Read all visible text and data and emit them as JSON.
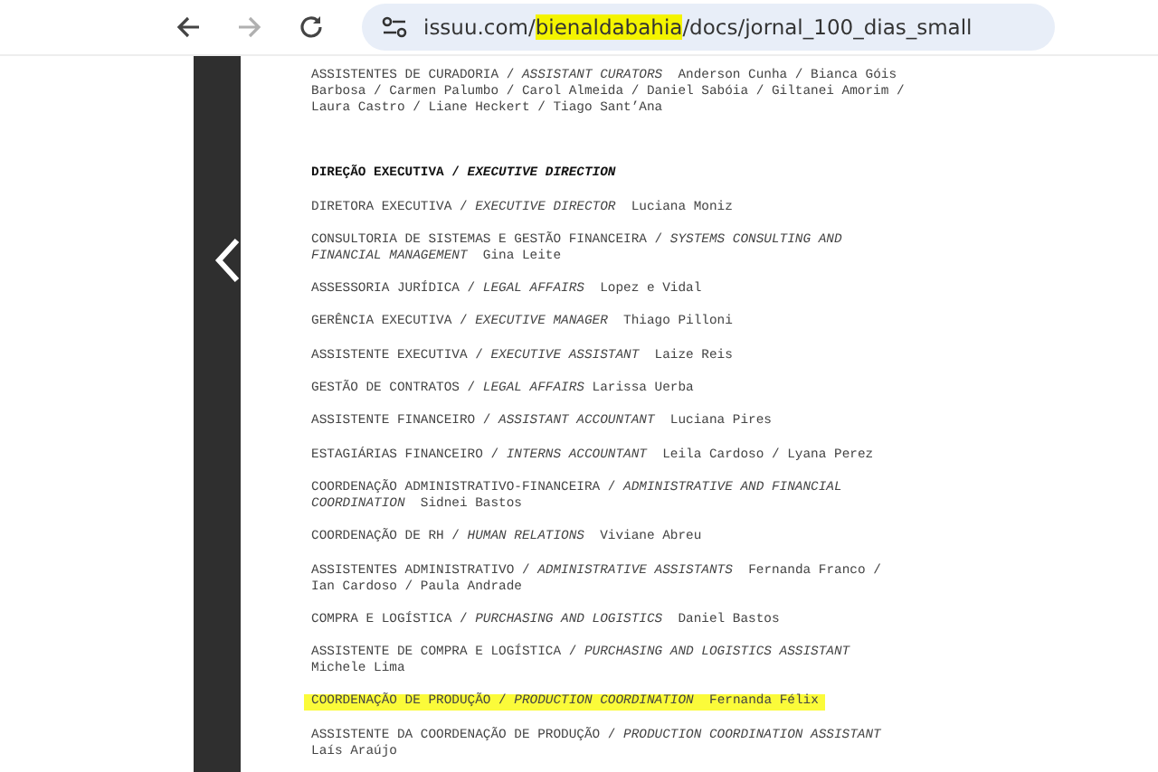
{
  "toolbar": {
    "url": [
      {
        "text": "issuu.com/",
        "highlighted": false
      },
      {
        "text": "bienaldabahia",
        "highlighted": true
      },
      {
        "text": "/docs/jornal_100_dias_small",
        "highlighted": false
      }
    ]
  },
  "document": {
    "entries": [
      {
        "kind": "credit",
        "highlighted": false,
        "text": "ASSISTENTES DE CURADORIA / *ASSISTANT CURATORS*  Anderson Cunha / Bianca Góis Barbosa / Carmen Palumbo / Carol Almeida / Daniel Sabóia / Giltanei Amorim / Laura Castro / Liane Heckert / Tiago Sant’Ana"
      },
      {
        "kind": "heading",
        "highlighted": false,
        "text": "DIREÇÃO EXECUTIVA / *EXECUTIVE DIRECTION*"
      },
      {
        "kind": "credit",
        "highlighted": false,
        "text": "DIRETORA EXECUTIVA / *EXECUTIVE DIRECTOR*  Luciana Moniz"
      },
      {
        "kind": "credit",
        "highlighted": false,
        "text": "CONSULTORIA DE SISTEMAS E GESTÃO FINANCEIRA / *SYSTEMS CONSULTING AND FINANCIAL MANAGEMENT*  Gina Leite"
      },
      {
        "kind": "credit",
        "highlighted": false,
        "text": "ASSESSORIA JURÍDICA / *LEGAL AFFAIRS*  Lopez e Vidal"
      },
      {
        "kind": "credit",
        "highlighted": false,
        "text": "GERÊNCIA EXECUTIVA / *EXECUTIVE MANAGER*  Thiago Pilloni"
      },
      {
        "kind": "credit",
        "highlighted": false,
        "text": "ASSISTENTE EXECUTIVA / *EXECUTIVE ASSISTANT*  Laize Reis"
      },
      {
        "kind": "credit",
        "highlighted": false,
        "text": "GESTÃO DE CONTRATOS / *LEGAL AFFAIRS* Larissa Uerba"
      },
      {
        "kind": "credit",
        "highlighted": false,
        "text": "ASSISTENTE FINANCEIRO / *ASSISTANT ACCOUNTANT*  Luciana Pires"
      },
      {
        "kind": "credit",
        "highlighted": false,
        "text": "ESTAGIÁRIAS FINANCEIRO / *INTERNS ACCOUNTANT*  Leila Cardoso / Lyana Perez"
      },
      {
        "kind": "credit",
        "highlighted": false,
        "text": "COORDENAÇÃO ADMINISTRATIVO-FINANCEIRA / *ADMINISTRATIVE AND FINANCIAL COORDINATION*  Sidnei Bastos"
      },
      {
        "kind": "credit",
        "highlighted": false,
        "text": "COORDENAÇÃO DE RH / *HUMAN RELATIONS*  Viviane Abreu"
      },
      {
        "kind": "credit",
        "highlighted": false,
        "text": "ASSISTENTES ADMINISTRATIVO / *ADMINISTRATIVE ASSISTANTS*  Fernanda Franco / Ian Cardoso / Paula Andrade"
      },
      {
        "kind": "credit",
        "highlighted": false,
        "text": "COMPRA E LOGÍSTICA / *PURCHASING AND LOGISTICS*  Daniel Bastos"
      },
      {
        "kind": "credit",
        "highlighted": false,
        "text": "ASSISTENTE DE COMPRA E LOGÍSTICA / *PURCHASING AND LOGISTICS ASSISTANT* Michele Lima"
      },
      {
        "kind": "credit",
        "highlighted": true,
        "text": "COORDENAÇÃO DE PRODUÇÃO / *PRODUCTION COORDINATION*  Fernanda Félix"
      },
      {
        "kind": "credit",
        "highlighted": false,
        "text": "ASSISTENTE DA COORDENAÇÃO DE PRODUÇÃO / *PRODUCTION COORDINATION ASSISTANT* Laís Araújo"
      }
    ]
  }
}
